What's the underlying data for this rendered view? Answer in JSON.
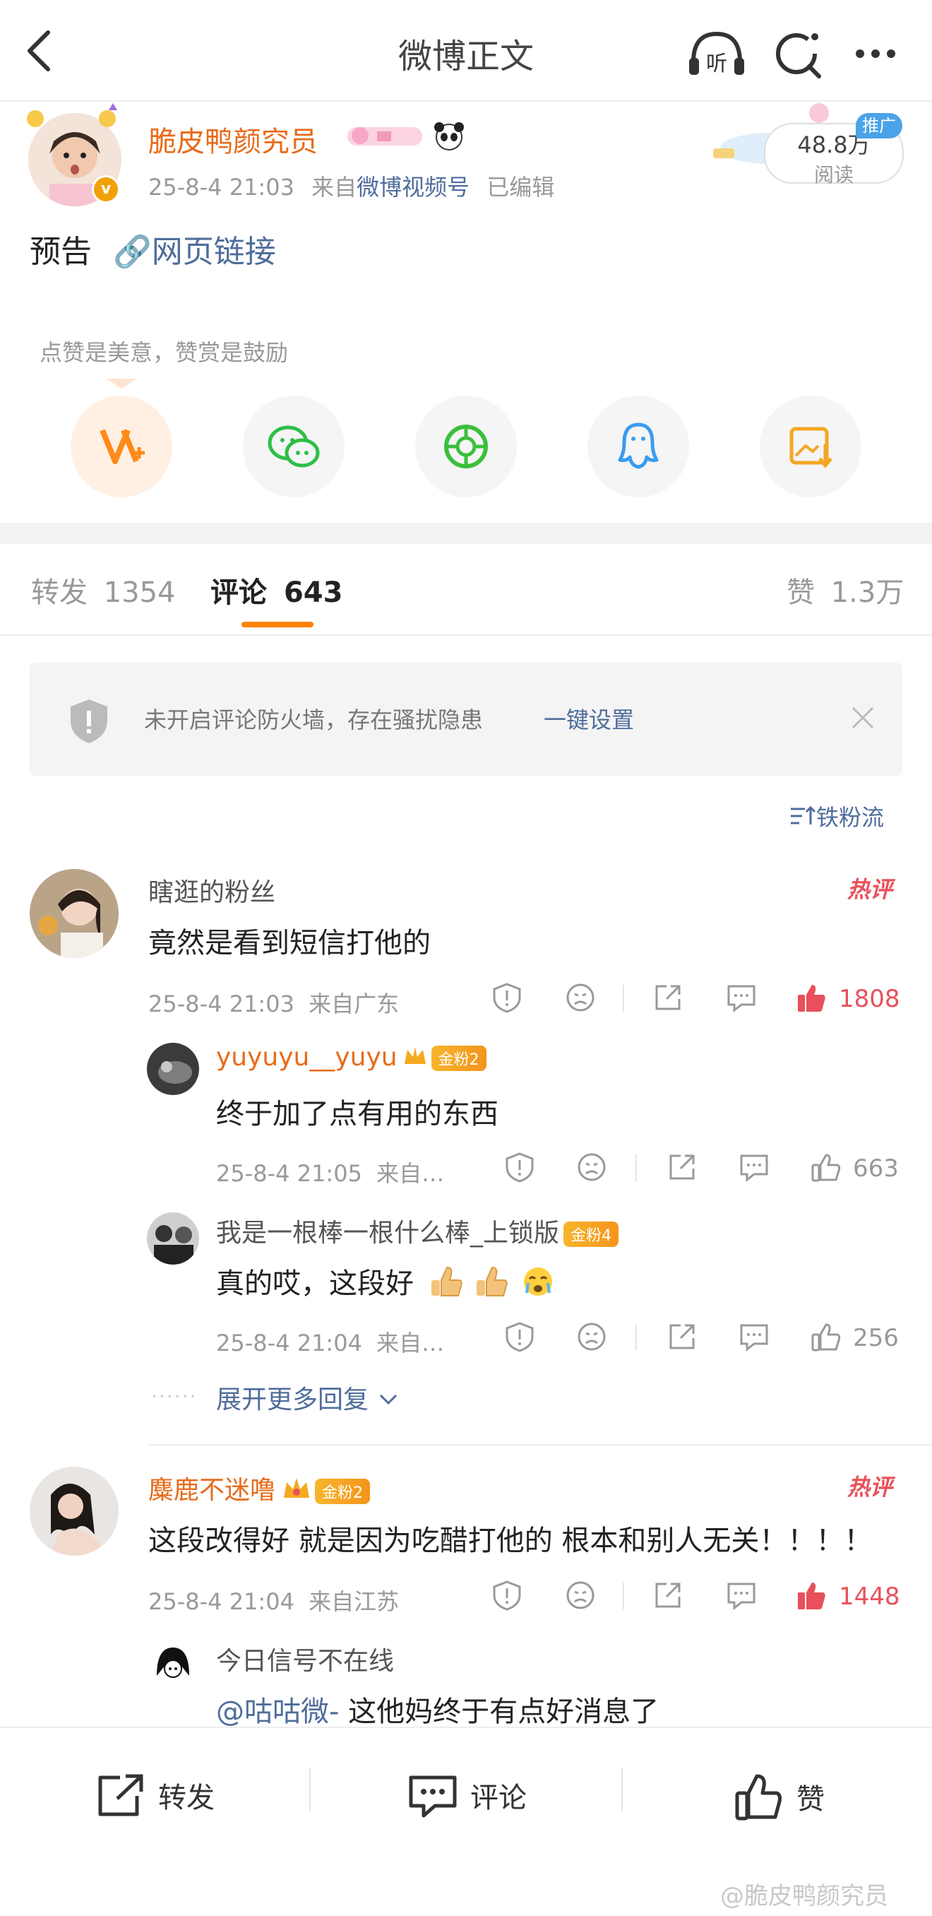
{
  "nav": {
    "title": "微博正文",
    "listen_label": "听"
  },
  "post": {
    "author": "脆皮鸭颜究员",
    "time": "25-8-4 21:03",
    "from_prefix": "来自",
    "source": "微博视频号",
    "edited": "已编辑",
    "text": "预告",
    "link_text": "网页链接",
    "reads_value": "48.8万",
    "reads_label": "阅读",
    "promo_tag": "推广"
  },
  "reward": {
    "tip_text": "点赞是美意，赞赏是鼓励",
    "share_icons": [
      "vplus-icon",
      "wechat-icon",
      "moments-icon",
      "qq-icon",
      "save-image-icon"
    ]
  },
  "tabs": {
    "repost_label": "转发",
    "repost_count": "1354",
    "comment_label": "评论",
    "comment_count": "643",
    "like_label": "赞",
    "like_count": "1.3万"
  },
  "firewall": {
    "text": "未开启评论防火墙，存在骚扰隐患",
    "action": "一键设置"
  },
  "sort": {
    "label": "铁粉流"
  },
  "comments": [
    {
      "user": "瞎逛的粉丝",
      "text": "竟然是看到短信打他的",
      "time": "25-8-4 21:03",
      "location": "来自广东",
      "likes": "1808",
      "hot_label": "热评",
      "replies": [
        {
          "user": "yuyuyu__yuyu",
          "badge": "金粉2",
          "text": "终于加了点有用的东西",
          "time": "25-8-4 21:05",
          "location": "来自…",
          "likes": "663"
        },
        {
          "user": "我是一根棒一根什么棒_上锁版",
          "badge": "金粉4",
          "text": "真的哎，这段好",
          "time": "25-8-4 21:04",
          "location": "来自…",
          "likes": "256"
        }
      ],
      "expand_label": "展开更多回复"
    },
    {
      "user": "麋鹿不迷噜",
      "badge": "金粉2",
      "text": "这段改得好 就是因为吃醋打他的 根本和别人无关！！！！",
      "time": "25-8-4 21:04",
      "location": "来自江苏",
      "likes": "1448",
      "hot_label": "热评",
      "replies": [
        {
          "user": "今日信号不在线",
          "mention": "@咕咕微-",
          "text": "这他妈终于有点好消息了"
        }
      ]
    }
  ],
  "bottom": {
    "repost": "转发",
    "comment": "评论",
    "like": "赞"
  },
  "watermark": "@脆皮鸭颜究员",
  "colors": {
    "accent": "#ff8200",
    "name_orange": "#e86b1a",
    "link_blue": "#4f6d9b",
    "like_red": "#e8505b"
  }
}
